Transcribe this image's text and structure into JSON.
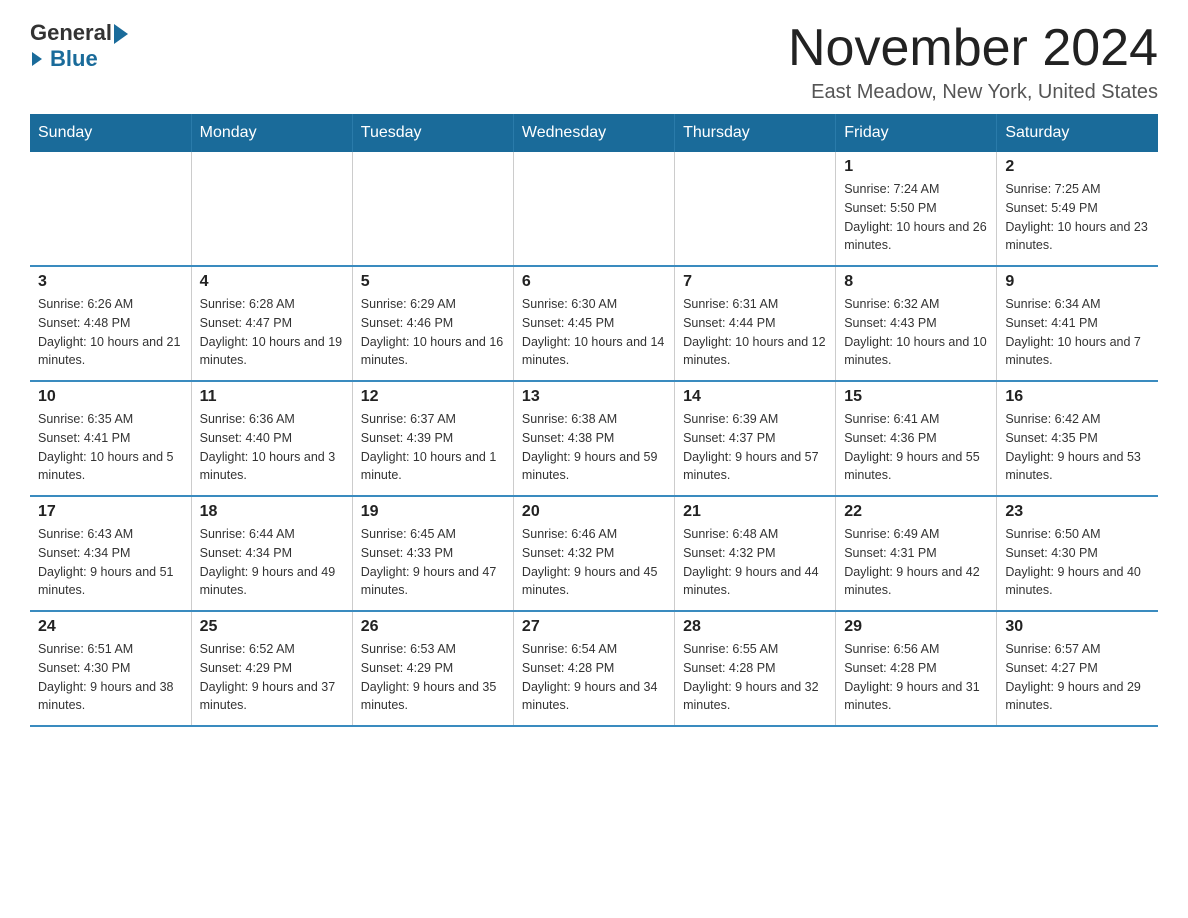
{
  "logo": {
    "general": "General",
    "blue": "Blue"
  },
  "title": "November 2024",
  "location": "East Meadow, New York, United States",
  "days_of_week": [
    "Sunday",
    "Monday",
    "Tuesday",
    "Wednesday",
    "Thursday",
    "Friday",
    "Saturday"
  ],
  "weeks": [
    [
      {
        "day": "",
        "info": ""
      },
      {
        "day": "",
        "info": ""
      },
      {
        "day": "",
        "info": ""
      },
      {
        "day": "",
        "info": ""
      },
      {
        "day": "",
        "info": ""
      },
      {
        "day": "1",
        "info": "Sunrise: 7:24 AM\nSunset: 5:50 PM\nDaylight: 10 hours and 26 minutes."
      },
      {
        "day": "2",
        "info": "Sunrise: 7:25 AM\nSunset: 5:49 PM\nDaylight: 10 hours and 23 minutes."
      }
    ],
    [
      {
        "day": "3",
        "info": "Sunrise: 6:26 AM\nSunset: 4:48 PM\nDaylight: 10 hours and 21 minutes."
      },
      {
        "day": "4",
        "info": "Sunrise: 6:28 AM\nSunset: 4:47 PM\nDaylight: 10 hours and 19 minutes."
      },
      {
        "day": "5",
        "info": "Sunrise: 6:29 AM\nSunset: 4:46 PM\nDaylight: 10 hours and 16 minutes."
      },
      {
        "day": "6",
        "info": "Sunrise: 6:30 AM\nSunset: 4:45 PM\nDaylight: 10 hours and 14 minutes."
      },
      {
        "day": "7",
        "info": "Sunrise: 6:31 AM\nSunset: 4:44 PM\nDaylight: 10 hours and 12 minutes."
      },
      {
        "day": "8",
        "info": "Sunrise: 6:32 AM\nSunset: 4:43 PM\nDaylight: 10 hours and 10 minutes."
      },
      {
        "day": "9",
        "info": "Sunrise: 6:34 AM\nSunset: 4:41 PM\nDaylight: 10 hours and 7 minutes."
      }
    ],
    [
      {
        "day": "10",
        "info": "Sunrise: 6:35 AM\nSunset: 4:41 PM\nDaylight: 10 hours and 5 minutes."
      },
      {
        "day": "11",
        "info": "Sunrise: 6:36 AM\nSunset: 4:40 PM\nDaylight: 10 hours and 3 minutes."
      },
      {
        "day": "12",
        "info": "Sunrise: 6:37 AM\nSunset: 4:39 PM\nDaylight: 10 hours and 1 minute."
      },
      {
        "day": "13",
        "info": "Sunrise: 6:38 AM\nSunset: 4:38 PM\nDaylight: 9 hours and 59 minutes."
      },
      {
        "day": "14",
        "info": "Sunrise: 6:39 AM\nSunset: 4:37 PM\nDaylight: 9 hours and 57 minutes."
      },
      {
        "day": "15",
        "info": "Sunrise: 6:41 AM\nSunset: 4:36 PM\nDaylight: 9 hours and 55 minutes."
      },
      {
        "day": "16",
        "info": "Sunrise: 6:42 AM\nSunset: 4:35 PM\nDaylight: 9 hours and 53 minutes."
      }
    ],
    [
      {
        "day": "17",
        "info": "Sunrise: 6:43 AM\nSunset: 4:34 PM\nDaylight: 9 hours and 51 minutes."
      },
      {
        "day": "18",
        "info": "Sunrise: 6:44 AM\nSunset: 4:34 PM\nDaylight: 9 hours and 49 minutes."
      },
      {
        "day": "19",
        "info": "Sunrise: 6:45 AM\nSunset: 4:33 PM\nDaylight: 9 hours and 47 minutes."
      },
      {
        "day": "20",
        "info": "Sunrise: 6:46 AM\nSunset: 4:32 PM\nDaylight: 9 hours and 45 minutes."
      },
      {
        "day": "21",
        "info": "Sunrise: 6:48 AM\nSunset: 4:32 PM\nDaylight: 9 hours and 44 minutes."
      },
      {
        "day": "22",
        "info": "Sunrise: 6:49 AM\nSunset: 4:31 PM\nDaylight: 9 hours and 42 minutes."
      },
      {
        "day": "23",
        "info": "Sunrise: 6:50 AM\nSunset: 4:30 PM\nDaylight: 9 hours and 40 minutes."
      }
    ],
    [
      {
        "day": "24",
        "info": "Sunrise: 6:51 AM\nSunset: 4:30 PM\nDaylight: 9 hours and 38 minutes."
      },
      {
        "day": "25",
        "info": "Sunrise: 6:52 AM\nSunset: 4:29 PM\nDaylight: 9 hours and 37 minutes."
      },
      {
        "day": "26",
        "info": "Sunrise: 6:53 AM\nSunset: 4:29 PM\nDaylight: 9 hours and 35 minutes."
      },
      {
        "day": "27",
        "info": "Sunrise: 6:54 AM\nSunset: 4:28 PM\nDaylight: 9 hours and 34 minutes."
      },
      {
        "day": "28",
        "info": "Sunrise: 6:55 AM\nSunset: 4:28 PM\nDaylight: 9 hours and 32 minutes."
      },
      {
        "day": "29",
        "info": "Sunrise: 6:56 AM\nSunset: 4:28 PM\nDaylight: 9 hours and 31 minutes."
      },
      {
        "day": "30",
        "info": "Sunrise: 6:57 AM\nSunset: 4:27 PM\nDaylight: 9 hours and 29 minutes."
      }
    ]
  ]
}
